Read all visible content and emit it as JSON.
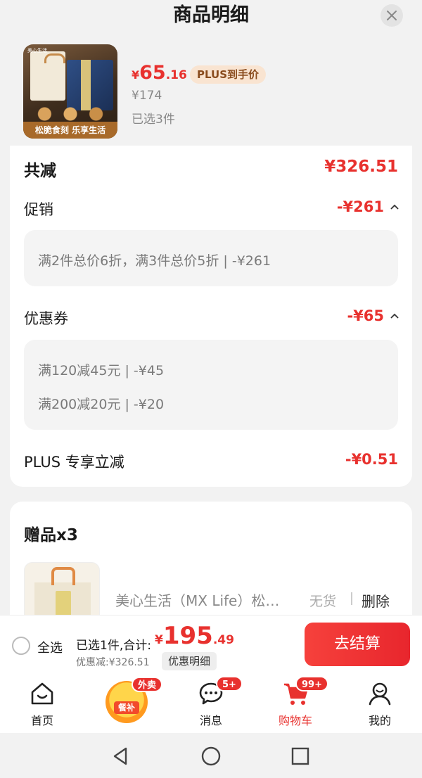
{
  "sheet": {
    "title": "商品明细",
    "close_icon": "close-icon"
  },
  "product": {
    "image_caption": "松脆食刻 乐享生活",
    "image_brand": "美心生活",
    "price_symbol": "¥",
    "price_int": "65",
    "price_dec": ".16",
    "plus_tag": "PLUS到手价",
    "original_price": "¥174",
    "selected": "已选3件"
  },
  "discounts": {
    "total_label": "共减",
    "total_value": "¥326.51",
    "promo_label": "促销",
    "promo_value": "-¥261",
    "promo_details": [
      "满2件总价6折，满3件总价5折 | -¥261"
    ],
    "coupon_label": "优惠券",
    "coupon_value": "-¥65",
    "coupon_details": [
      "满120减45元 | -¥45",
      "满200减20元 | -¥20"
    ],
    "plus_label": "PLUS 专享立减",
    "plus_value": "-¥0.51"
  },
  "gifts": {
    "title": "赠品x3",
    "item_name": "美心生活（MX Life）松…",
    "stock": "无货",
    "delete": "删除"
  },
  "checkout": {
    "select_all": "全选",
    "summary_label": "已选1件,合计:",
    "sum_symbol": "¥",
    "sum_int": "195",
    "sum_dec": ".49",
    "discount_total": "优惠减:¥326.51",
    "detail_button": "优惠明细",
    "checkout_button": "去结算"
  },
  "tabbar": {
    "home": "首页",
    "food_badge": "外卖",
    "food_label": "餐补",
    "messages": "消息",
    "messages_badge": "5+",
    "cart": "购物车",
    "cart_badge": "99+",
    "mine": "我的"
  },
  "colors": {
    "accent": "#e8312e",
    "plus_tag_bg": "#f9e4d1"
  }
}
